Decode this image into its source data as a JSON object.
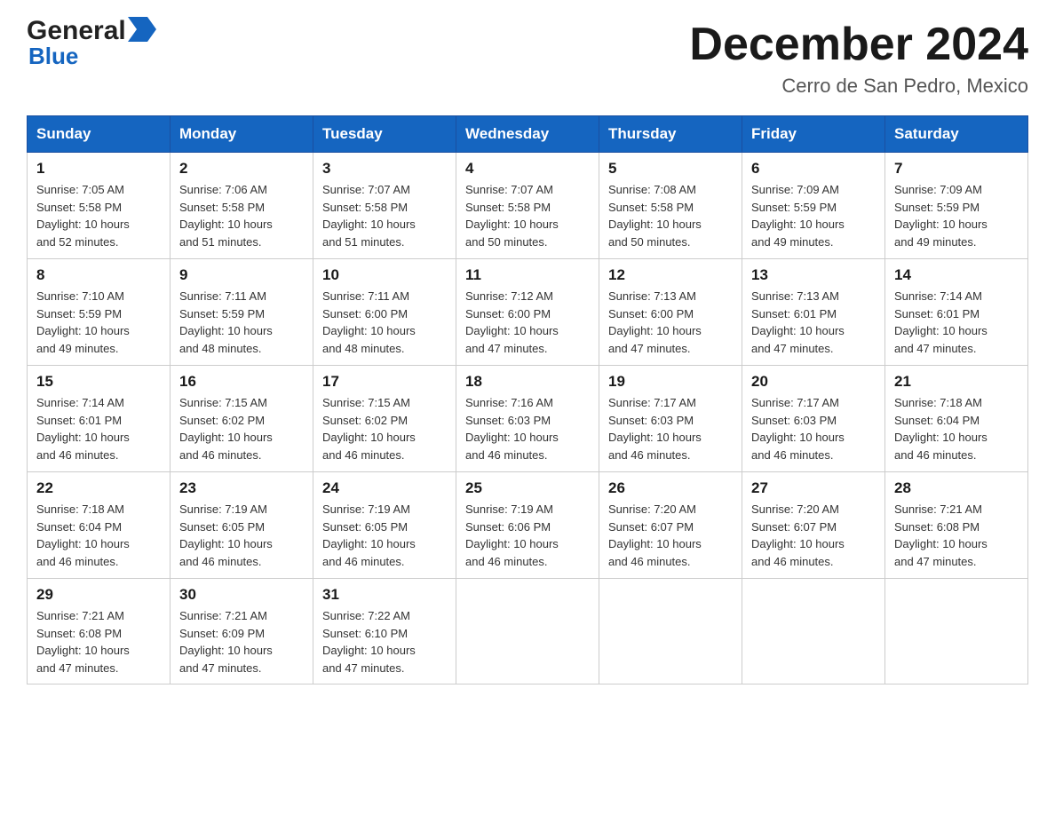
{
  "header": {
    "month_title": "December 2024",
    "location": "Cerro de San Pedro, Mexico"
  },
  "logo": {
    "general": "General",
    "blue": "Blue"
  },
  "columns": [
    "Sunday",
    "Monday",
    "Tuesday",
    "Wednesday",
    "Thursday",
    "Friday",
    "Saturday"
  ],
  "weeks": [
    [
      {
        "day": "1",
        "info": "Sunrise: 7:05 AM\nSunset: 5:58 PM\nDaylight: 10 hours\nand 52 minutes."
      },
      {
        "day": "2",
        "info": "Sunrise: 7:06 AM\nSunset: 5:58 PM\nDaylight: 10 hours\nand 51 minutes."
      },
      {
        "day": "3",
        "info": "Sunrise: 7:07 AM\nSunset: 5:58 PM\nDaylight: 10 hours\nand 51 minutes."
      },
      {
        "day": "4",
        "info": "Sunrise: 7:07 AM\nSunset: 5:58 PM\nDaylight: 10 hours\nand 50 minutes."
      },
      {
        "day": "5",
        "info": "Sunrise: 7:08 AM\nSunset: 5:58 PM\nDaylight: 10 hours\nand 50 minutes."
      },
      {
        "day": "6",
        "info": "Sunrise: 7:09 AM\nSunset: 5:59 PM\nDaylight: 10 hours\nand 49 minutes."
      },
      {
        "day": "7",
        "info": "Sunrise: 7:09 AM\nSunset: 5:59 PM\nDaylight: 10 hours\nand 49 minutes."
      }
    ],
    [
      {
        "day": "8",
        "info": "Sunrise: 7:10 AM\nSunset: 5:59 PM\nDaylight: 10 hours\nand 49 minutes."
      },
      {
        "day": "9",
        "info": "Sunrise: 7:11 AM\nSunset: 5:59 PM\nDaylight: 10 hours\nand 48 minutes."
      },
      {
        "day": "10",
        "info": "Sunrise: 7:11 AM\nSunset: 6:00 PM\nDaylight: 10 hours\nand 48 minutes."
      },
      {
        "day": "11",
        "info": "Sunrise: 7:12 AM\nSunset: 6:00 PM\nDaylight: 10 hours\nand 47 minutes."
      },
      {
        "day": "12",
        "info": "Sunrise: 7:13 AM\nSunset: 6:00 PM\nDaylight: 10 hours\nand 47 minutes."
      },
      {
        "day": "13",
        "info": "Sunrise: 7:13 AM\nSunset: 6:01 PM\nDaylight: 10 hours\nand 47 minutes."
      },
      {
        "day": "14",
        "info": "Sunrise: 7:14 AM\nSunset: 6:01 PM\nDaylight: 10 hours\nand 47 minutes."
      }
    ],
    [
      {
        "day": "15",
        "info": "Sunrise: 7:14 AM\nSunset: 6:01 PM\nDaylight: 10 hours\nand 46 minutes."
      },
      {
        "day": "16",
        "info": "Sunrise: 7:15 AM\nSunset: 6:02 PM\nDaylight: 10 hours\nand 46 minutes."
      },
      {
        "day": "17",
        "info": "Sunrise: 7:15 AM\nSunset: 6:02 PM\nDaylight: 10 hours\nand 46 minutes."
      },
      {
        "day": "18",
        "info": "Sunrise: 7:16 AM\nSunset: 6:03 PM\nDaylight: 10 hours\nand 46 minutes."
      },
      {
        "day": "19",
        "info": "Sunrise: 7:17 AM\nSunset: 6:03 PM\nDaylight: 10 hours\nand 46 minutes."
      },
      {
        "day": "20",
        "info": "Sunrise: 7:17 AM\nSunset: 6:03 PM\nDaylight: 10 hours\nand 46 minutes."
      },
      {
        "day": "21",
        "info": "Sunrise: 7:18 AM\nSunset: 6:04 PM\nDaylight: 10 hours\nand 46 minutes."
      }
    ],
    [
      {
        "day": "22",
        "info": "Sunrise: 7:18 AM\nSunset: 6:04 PM\nDaylight: 10 hours\nand 46 minutes."
      },
      {
        "day": "23",
        "info": "Sunrise: 7:19 AM\nSunset: 6:05 PM\nDaylight: 10 hours\nand 46 minutes."
      },
      {
        "day": "24",
        "info": "Sunrise: 7:19 AM\nSunset: 6:05 PM\nDaylight: 10 hours\nand 46 minutes."
      },
      {
        "day": "25",
        "info": "Sunrise: 7:19 AM\nSunset: 6:06 PM\nDaylight: 10 hours\nand 46 minutes."
      },
      {
        "day": "26",
        "info": "Sunrise: 7:20 AM\nSunset: 6:07 PM\nDaylight: 10 hours\nand 46 minutes."
      },
      {
        "day": "27",
        "info": "Sunrise: 7:20 AM\nSunset: 6:07 PM\nDaylight: 10 hours\nand 46 minutes."
      },
      {
        "day": "28",
        "info": "Sunrise: 7:21 AM\nSunset: 6:08 PM\nDaylight: 10 hours\nand 47 minutes."
      }
    ],
    [
      {
        "day": "29",
        "info": "Sunrise: 7:21 AM\nSunset: 6:08 PM\nDaylight: 10 hours\nand 47 minutes."
      },
      {
        "day": "30",
        "info": "Sunrise: 7:21 AM\nSunset: 6:09 PM\nDaylight: 10 hours\nand 47 minutes."
      },
      {
        "day": "31",
        "info": "Sunrise: 7:22 AM\nSunset: 6:10 PM\nDaylight: 10 hours\nand 47 minutes."
      },
      {
        "day": "",
        "info": ""
      },
      {
        "day": "",
        "info": ""
      },
      {
        "day": "",
        "info": ""
      },
      {
        "day": "",
        "info": ""
      }
    ]
  ]
}
